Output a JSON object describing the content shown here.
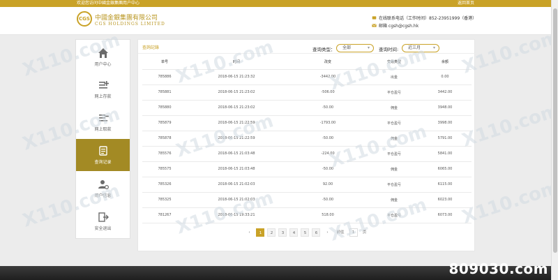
{
  "topbar": {
    "welcome": "欢迎您访问中國金銀集團用户中心",
    "back": "返回首页"
  },
  "header": {
    "logo_mark": "CGS",
    "company_cn": "中國金銀集團有限公司",
    "company_en": "CGS HOLDINGS LIMITED",
    "phone": "在线联系电话（工作时间）852-23951999（香港）",
    "email": "邮箱 cgsh@cgsh.hk"
  },
  "sidebar": {
    "items": [
      {
        "label": "用户中心",
        "icon": "home-icon"
      },
      {
        "label": "网上存款",
        "icon": "deposit-icon"
      },
      {
        "label": "网上取款",
        "icon": "withdraw-icon"
      },
      {
        "label": "查询记录",
        "icon": "records-icon"
      },
      {
        "label": "用户信息",
        "icon": "user-settings-icon"
      },
      {
        "label": "安全退出",
        "icon": "logout-icon"
      }
    ]
  },
  "panel": {
    "title": "查詢記錄",
    "type_label": "查询类型：",
    "type_value": "全部",
    "time_label": "查询时间:",
    "time_value": "近三月"
  },
  "table": {
    "headers": [
      "单号",
      "时间",
      "改变",
      "交易类型",
      "余额"
    ],
    "rows": [
      [
        "785886",
        "2018-06-15 21:23:32",
        "-3442.00",
        "出金",
        "0.00"
      ],
      [
        "785881",
        "2018-06-15 21:23:02",
        "-506.00",
        "平仓盈亏",
        "3442.00"
      ],
      [
        "785880",
        "2018-06-15 21:23:02",
        "-50.00",
        "佣金",
        "3948.00"
      ],
      [
        "785879",
        "2018-06-15 21:22:59",
        "-1793.00",
        "平仓盈亏",
        "3998.00"
      ],
      [
        "785878",
        "2018-06-15 21:22:59",
        "-50.00",
        "佣金",
        "5791.00"
      ],
      [
        "785576",
        "2018-06-15 21:03:48",
        "-224.00",
        "平仓盈亏",
        "5841.00"
      ],
      [
        "785575",
        "2018-06-15 21:03:48",
        "-50.00",
        "佣金",
        "6065.00"
      ],
      [
        "785326",
        "2018-06-15 21:02:03",
        "92.00",
        "平仓盈亏",
        "6115.00"
      ],
      [
        "785325",
        "2018-06-15 21:02:03",
        "-50.00",
        "佣金",
        "6023.00"
      ],
      [
        "781267",
        "2018-06-15 19:33:21",
        "518.00",
        "平仓盈亏",
        "6073.00"
      ]
    ]
  },
  "pager": {
    "prev": "‹",
    "pages": [
      "1",
      "2",
      "3",
      "4",
      "5",
      "6"
    ],
    "next": "›",
    "goto_label": "前往",
    "goto_value": "1",
    "page_unit": "页"
  },
  "watermark": {
    "text": "X110.com"
  },
  "brand": {
    "text": "809030.com"
  },
  "colors": {
    "accent": "#c9a227",
    "active_nav": "#a38a24"
  }
}
